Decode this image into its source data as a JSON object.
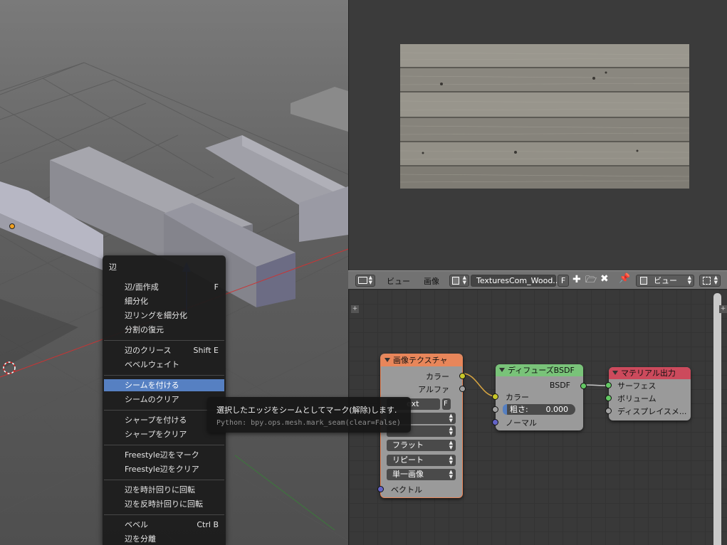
{
  "context_menu": {
    "title": "辺",
    "items": [
      {
        "label": "辺/面作成",
        "shortcut": "F"
      },
      {
        "label": "細分化",
        "shortcut": ""
      },
      {
        "label": "辺リングを細分化",
        "shortcut": ""
      },
      {
        "label": "分割の復元",
        "shortcut": ""
      },
      {
        "label": "辺のクリース",
        "shortcut": "Shift E"
      },
      {
        "label": "ベベルウェイト",
        "shortcut": ""
      },
      {
        "label": "シームを付ける",
        "shortcut": ""
      },
      {
        "label": "シームのクリア",
        "shortcut": ""
      },
      {
        "label": "シャープを付ける",
        "shortcut": ""
      },
      {
        "label": "シャープをクリア",
        "shortcut": ""
      },
      {
        "label": "Freestyle辺をマーク",
        "shortcut": ""
      },
      {
        "label": "Freestyle辺をクリア",
        "shortcut": ""
      },
      {
        "label": "辺を時計回りに回転",
        "shortcut": ""
      },
      {
        "label": "辺を反時計回りに回転",
        "shortcut": ""
      },
      {
        "label": "ベベル",
        "shortcut": "Ctrl B"
      },
      {
        "label": "辺を分離",
        "shortcut": ""
      }
    ]
  },
  "tooltip": {
    "description": "選択したエッジをシームとしてマーク(解除)します.",
    "python": "Python: bpy.ops.mesh.mark_seam(clear=False)"
  },
  "image_editor_header": {
    "view_menu": "ビュー",
    "image_menu": "画像",
    "image_name": "TexturesCom_Wood...",
    "fake_user": "F",
    "view_mode": "ビュー"
  },
  "nodes": {
    "image_texture": {
      "title": "画像テクスチャ",
      "out_color": "カラー",
      "out_alpha": "アルファ",
      "image_name_partial": "ext",
      "fake_user": "F",
      "interpolation": "",
      "projection_hidden": "",
      "projection": "フラット",
      "extension": "リピート",
      "source": "単一画像",
      "in_vector": "ベクトル"
    },
    "diffuse_bsdf": {
      "title": "ディフューズBSDF",
      "out_bsdf": "BSDF",
      "in_color": "カラー",
      "roughness_label": "粗さ:",
      "roughness_value": "0.000",
      "in_normal": "ノーマル"
    },
    "material_output": {
      "title": "マテリアル出力",
      "in_surface": "サーフェス",
      "in_volume": "ボリューム",
      "in_displacement": "ディスプレイスメ..."
    }
  },
  "colors": {
    "menu_highlight": "#5680c2",
    "node_header_texture": "#e8865a",
    "node_header_shader": "#79c379",
    "node_header_output": "#cc4a5c",
    "socket_color": "#c7c729",
    "socket_shader": "#63c763",
    "socket_value": "#a1a1a1",
    "socket_vector": "#6363c7"
  }
}
